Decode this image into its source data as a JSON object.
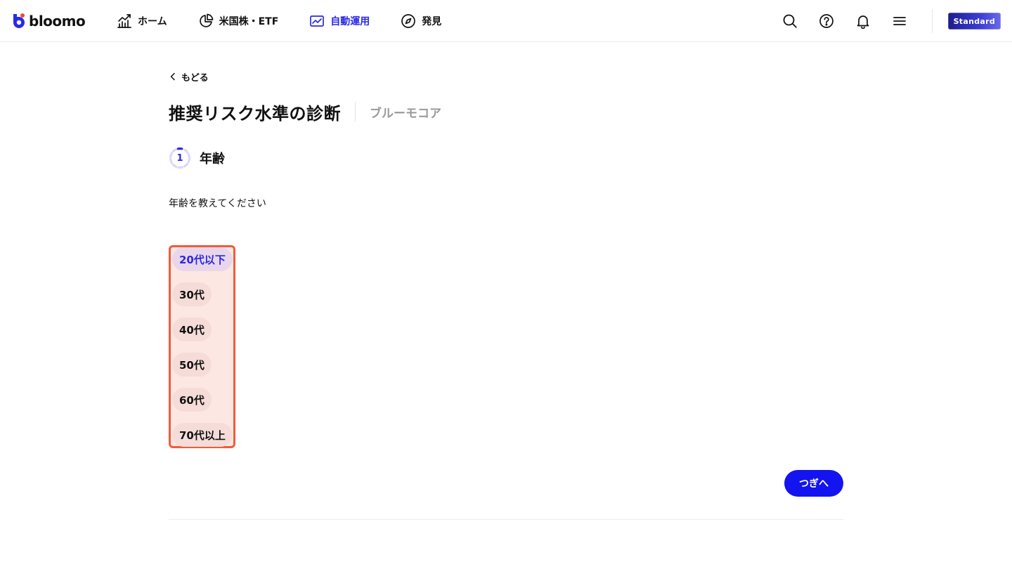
{
  "brand": {
    "name": "bloomo",
    "accent": "#2a2ae6"
  },
  "nav": {
    "items": [
      {
        "label": "ホーム",
        "icon": "chart-up-icon",
        "active": false
      },
      {
        "label": "米国株・ETF",
        "icon": "pie-chart-icon",
        "active": false
      },
      {
        "label": "自動運用",
        "icon": "trend-line-icon",
        "active": true
      },
      {
        "label": "発見",
        "icon": "compass-icon",
        "active": false
      }
    ]
  },
  "actions": {
    "icons": [
      "search-icon",
      "help-icon",
      "bell-icon",
      "menu-icon"
    ],
    "plan_badge": "Standard"
  },
  "page": {
    "back_label": "もどる",
    "title": "推奨リスク水準の診断",
    "subtitle": "ブルーモコア",
    "step": {
      "number": "1",
      "label": "年齢"
    },
    "question": "年齢を教えてください",
    "options": [
      {
        "label": "20代以下",
        "selected": true
      },
      {
        "label": "30代",
        "selected": false
      },
      {
        "label": "40代",
        "selected": false
      },
      {
        "label": "50代",
        "selected": false
      },
      {
        "label": "60代",
        "selected": false
      },
      {
        "label": "70代以上",
        "selected": false
      }
    ],
    "next_label": "つぎへ"
  },
  "colors": {
    "primary_button": "#1414f0",
    "highlight_border": "#f25b3c",
    "highlight_fill": "#fde7e2"
  }
}
